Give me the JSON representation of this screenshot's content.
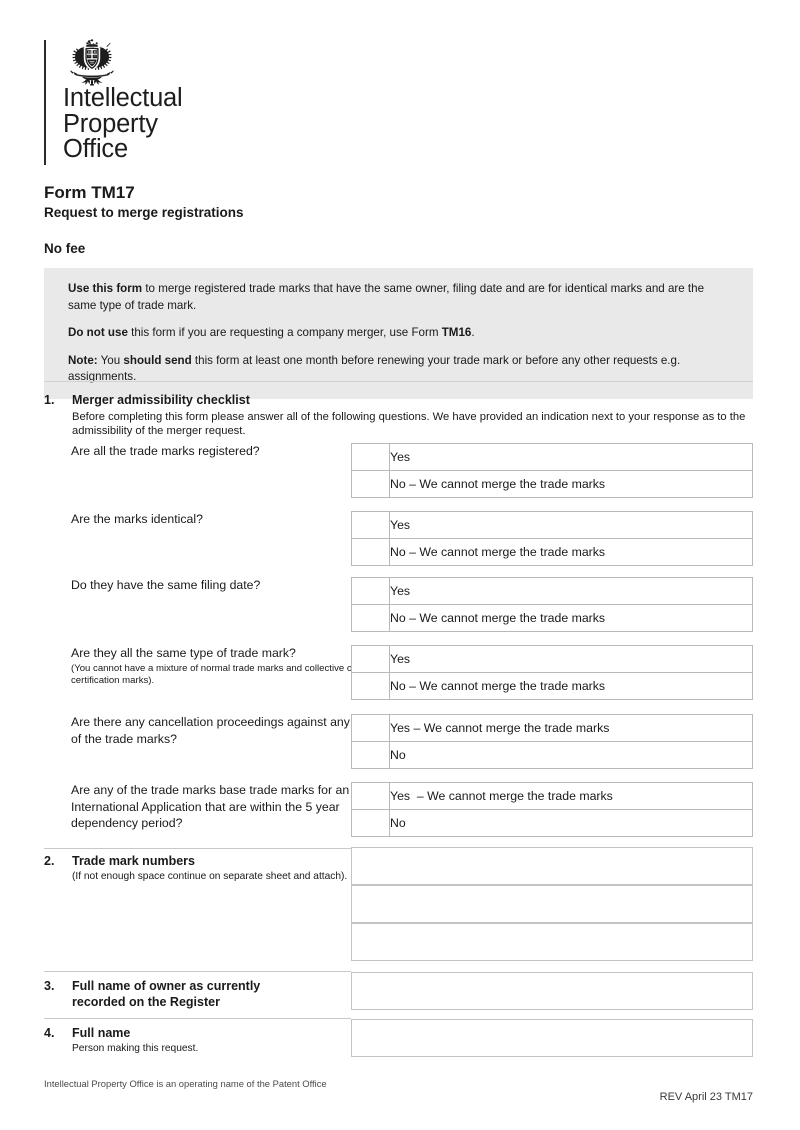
{
  "logo": {
    "crest_icon": "royal-coat-of-arms-icon",
    "line1": "Intellectual",
    "line2": "Property",
    "line3": "Office"
  },
  "title": {
    "form_title": "Form TM17",
    "form_subtitle": "Request to merge registrations",
    "fee": "No fee"
  },
  "infobox": {
    "p1_bold": "Use this form",
    "p1_rest": " to merge registered trade marks that have the same owner, filing date and are for identical marks and are the same type of trade mark.",
    "p2_bold": "Do not use",
    "p2_mid": " this form if you are requesting a company merger, use Form ",
    "p2_bold2": "TM16",
    "p2_end": ".",
    "p3_bold": "Note:",
    "p3_mid": " You ",
    "p3_bold2": "should send",
    "p3_end": " this form at least one month before renewing your trade mark or before any other requests e.g. assignments."
  },
  "sections": {
    "s1": {
      "number": "1.",
      "title": "Merger admissibility checklist",
      "desc": "Before completing this form please answer all of the following questions. We have provided an indication next to your response as to the admissibility of the merger request."
    },
    "s2": {
      "number": "2.",
      "title": "Trade mark numbers",
      "note": "(If not enough space continue on separate sheet and attach).",
      "value1": "",
      "value2": "",
      "value3": ""
    },
    "s3": {
      "number": "3.",
      "title_line1": "Full name of owner as currently",
      "title_line2": "recorded on the Register",
      "value": ""
    },
    "s4": {
      "number": "4.",
      "title": "Full name",
      "note": "Person making this request.",
      "value": ""
    }
  },
  "questions": [
    {
      "label": "Are all the trade marks registered?",
      "sub": "",
      "options": [
        {
          "text": "Yes",
          "checked": false
        },
        {
          "text": "No – We cannot merge the trade marks",
          "checked": false
        }
      ]
    },
    {
      "label": "Are the marks identical?",
      "sub": "",
      "options": [
        {
          "text": "Yes",
          "checked": false
        },
        {
          "text": "No – We cannot merge the trade marks",
          "checked": false
        }
      ]
    },
    {
      "label": "Do they have the same filing date?",
      "sub": "",
      "options": [
        {
          "text": "Yes",
          "checked": false
        },
        {
          "text": "No – We cannot merge the trade marks",
          "checked": false
        }
      ]
    },
    {
      "label": "Are they all the same type of trade mark?",
      "sub": "(You cannot have a mixture of normal trade marks and collective or certification marks).",
      "options": [
        {
          "text": "Yes",
          "checked": false
        },
        {
          "text": "No – We cannot merge the trade marks",
          "checked": false
        }
      ]
    },
    {
      "label": "Are there any cancellation proceedings against any of the trade marks?",
      "sub": "",
      "options": [
        {
          "text": "Yes – We cannot merge the trade marks",
          "checked": false
        },
        {
          "text": "No",
          "checked": false
        }
      ]
    },
    {
      "label": "Are any of the trade marks base trade marks for an International Application that are within the 5 year dependency period?",
      "sub": "",
      "options": [
        {
          "text": "Yes  – We cannot merge the trade marks",
          "checked": false
        },
        {
          "text": "No",
          "checked": false
        }
      ]
    }
  ],
  "footer": {
    "left": "Intellectual Property Office is an operating name of the Patent Office",
    "right": "REV April 23 TM17"
  },
  "colors": {
    "infobox_bg": "#e9e9e9",
    "border": "#b9b9b9",
    "rule": "#d2d2d2",
    "text": "#1a1a1a"
  }
}
